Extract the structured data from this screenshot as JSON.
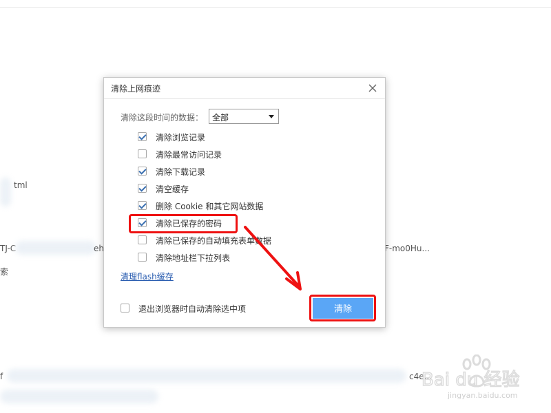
{
  "background": {
    "fragment_1": "tml",
    "fragment_2": "TJ-C",
    "fragment_3": "eh",
    "fragment_4": "索",
    "fragment_5": "F-mo0Hu...",
    "fragment_6": "c4e...",
    "fragment_7": "f"
  },
  "dialog": {
    "title": "清除上网痕迹",
    "range_label": "清除这段时间的数据：",
    "range_value": "全部",
    "options": [
      {
        "label": "清除浏览记录",
        "checked": true
      },
      {
        "label": "清除最常访问记录",
        "checked": false
      },
      {
        "label": "清除下载记录",
        "checked": true
      },
      {
        "label": "清空缓存",
        "checked": true
      },
      {
        "label": "删除 Cookie 和其它网站数据",
        "checked": true
      },
      {
        "label": "清除已保存的密码",
        "checked": true
      },
      {
        "label": "清除已保存的自动填充表单数据",
        "checked": false
      },
      {
        "label": "清除地址栏下拉列表",
        "checked": false
      }
    ],
    "flash_link": "清理flash缓存",
    "auto_clear_label": "退出浏览器时自动清除选中项",
    "auto_clear_checked": false,
    "clear_button": "清除"
  },
  "watermark": {
    "brand": "Bai du 经验",
    "url": "jingyan.baidu.com"
  },
  "colors": {
    "accent_button": "#5aa6f6",
    "annotation_red": "#e11111",
    "link": "#2a5db0"
  }
}
